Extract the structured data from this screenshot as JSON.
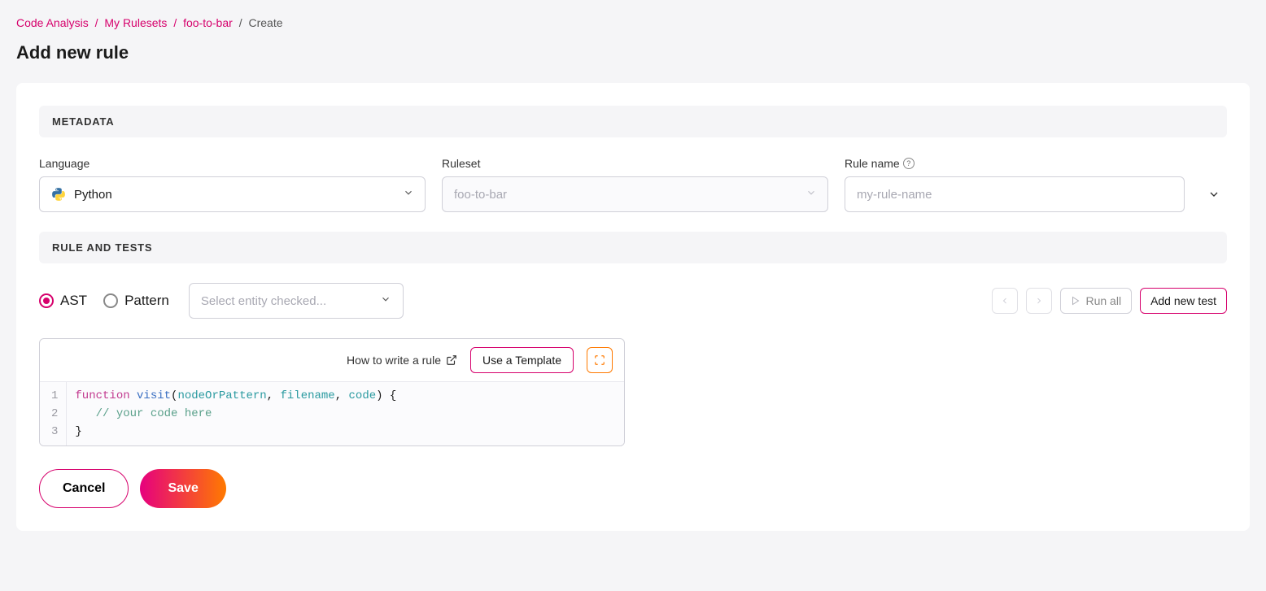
{
  "breadcrumb": {
    "items": [
      {
        "label": "Code Analysis"
      },
      {
        "label": "My Rulesets"
      },
      {
        "label": "foo-to-bar"
      }
    ],
    "current": "Create"
  },
  "page": {
    "title": "Add new rule"
  },
  "sections": {
    "metadata": "METADATA",
    "rule_and_tests": "RULE AND TESTS"
  },
  "form": {
    "language": {
      "label": "Language",
      "value": "Python"
    },
    "ruleset": {
      "label": "Ruleset",
      "value": "foo-to-bar"
    },
    "rulename": {
      "label": "Rule name",
      "placeholder": "my-rule-name",
      "value": ""
    }
  },
  "rule_type": {
    "ast": "AST",
    "pattern": "Pattern",
    "entity_placeholder": "Select entity checked..."
  },
  "toolbar": {
    "run_all": "Run all",
    "add_new_test": "Add new test"
  },
  "editor": {
    "how_to": "How to write a rule",
    "use_template": "Use a Template",
    "code": {
      "l1_kw": "function",
      "l1_fn": "visit",
      "l1_a1": "nodeOrPattern",
      "l1_a2": "filename",
      "l1_a3": "code",
      "l1_tail": ") {",
      "l2_comment": "// your code here",
      "l3": "}"
    }
  },
  "actions": {
    "cancel": "Cancel",
    "save": "Save"
  }
}
